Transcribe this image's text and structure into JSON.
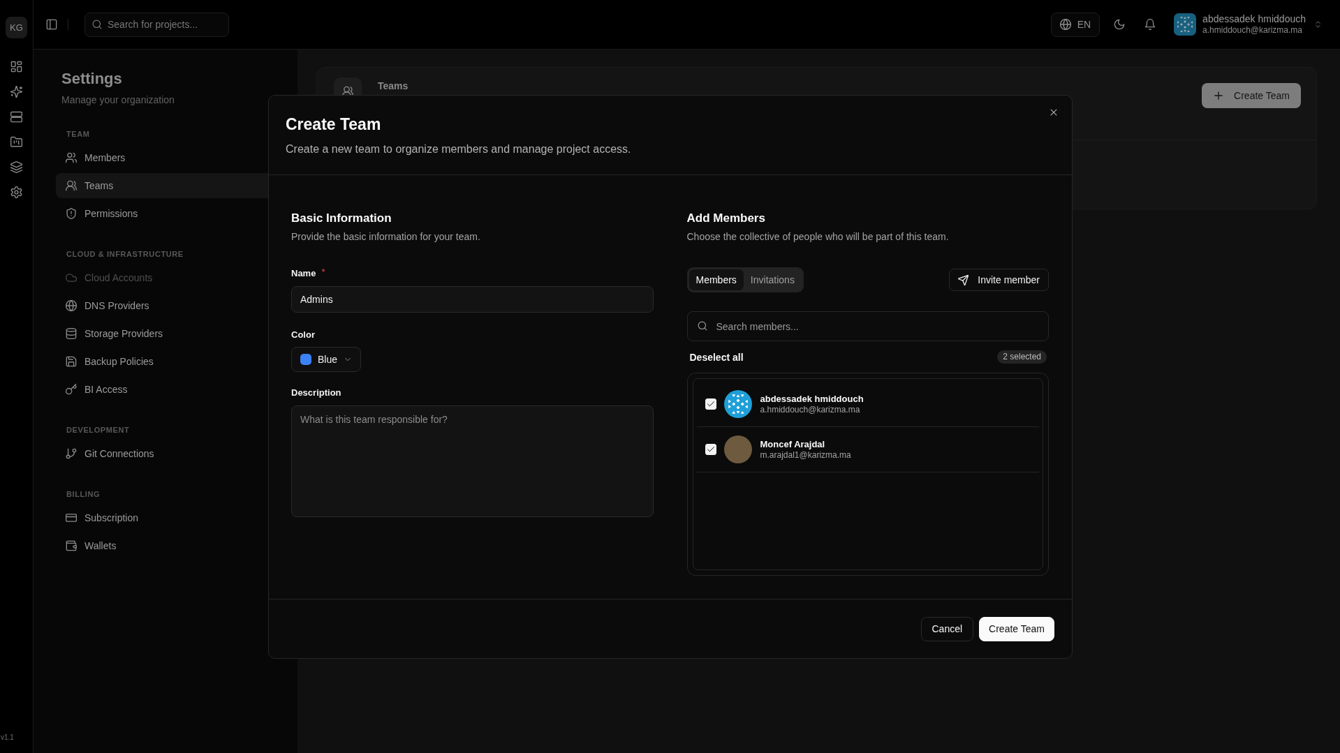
{
  "app": {
    "logo": "KG",
    "version": "v1.1"
  },
  "top_bar": {
    "search": {
      "placeholder": "Search for projects..."
    },
    "language": "EN",
    "user": {
      "name": "abdessadek hmiddouch",
      "email": "a.hmiddouch@karizma.ma"
    }
  },
  "settings": {
    "title": "Settings",
    "subtitle": "Manage your organization",
    "sections": [
      {
        "heading": "TEAM",
        "items": [
          {
            "label": "Members",
            "selected": false,
            "disabled": false
          },
          {
            "label": "Teams",
            "selected": true,
            "disabled": false
          },
          {
            "label": "Permissions",
            "selected": false,
            "disabled": false
          }
        ]
      },
      {
        "heading": "CLOUD & INFRASTRUCTURE",
        "items": [
          {
            "label": "Cloud Accounts",
            "selected": false,
            "disabled": true
          },
          {
            "label": "DNS Providers",
            "selected": false,
            "disabled": false
          },
          {
            "label": "Storage Providers",
            "selected": false,
            "disabled": false
          },
          {
            "label": "Backup Policies",
            "selected": false,
            "disabled": false
          },
          {
            "label": "BI Access",
            "selected": false,
            "disabled": false
          }
        ]
      },
      {
        "heading": "DEVELOPMENT",
        "items": [
          {
            "label": "Git Connections",
            "selected": false,
            "disabled": false
          }
        ]
      },
      {
        "heading": "BILLING",
        "items": [
          {
            "label": "Subscription",
            "selected": false,
            "disabled": false
          },
          {
            "label": "Wallets",
            "selected": false,
            "disabled": false
          }
        ]
      }
    ]
  },
  "page": {
    "title": "Teams",
    "create_button": "Create Team"
  },
  "dialog": {
    "title": "Create Team",
    "subtitle": "Create a new team to organize members and manage project access.",
    "basic": {
      "title": "Basic Information",
      "subtitle": "Provide the basic information for your team.",
      "name": {
        "label": "Name",
        "required_mark": "*",
        "value": "Admins"
      },
      "color": {
        "label": "Color",
        "value": "Blue",
        "color": "#3b82f6"
      },
      "description": {
        "label": "Description",
        "placeholder": "What is this team responsible for?"
      }
    },
    "members_panel": {
      "title": "Add Members",
      "subtitle": "Choose the collective of people who will be part of this team.",
      "tabs": [
        {
          "label": "Members",
          "selected": true
        },
        {
          "label": "Invitations",
          "selected": false
        }
      ],
      "invite_button": "Invite member",
      "search": {
        "placeholder": "Search members..."
      },
      "deselect_all": "Deselect all",
      "selected_count": "2 selected",
      "members": [
        {
          "name": "abdessadek hmiddouch",
          "email": "a.hmiddouch@karizma.ma",
          "checked": true,
          "kind": "identicon"
        },
        {
          "name": "Moncef Arajdal",
          "email": "m.arajdal1@karizma.ma",
          "checked": true,
          "kind": "photo"
        }
      ]
    },
    "buttons": [
      {
        "label": "Cancel",
        "kind": "secondary"
      },
      {
        "label": "Create Team",
        "kind": "primary"
      }
    ]
  }
}
